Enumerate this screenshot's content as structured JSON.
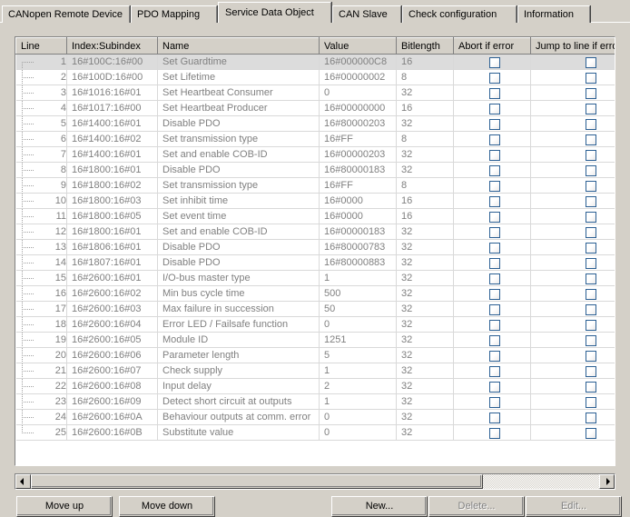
{
  "tabs": [
    {
      "label": "CANopen Remote Device",
      "active": false
    },
    {
      "label": "PDO Mapping",
      "active": false
    },
    {
      "label": "Service Data Object",
      "active": true
    },
    {
      "label": "CAN Slave",
      "active": false
    },
    {
      "label": "Check configuration",
      "active": false
    },
    {
      "label": "Information",
      "active": false
    }
  ],
  "grid": {
    "columns": [
      {
        "key": "line",
        "label": "Line"
      },
      {
        "key": "index",
        "label": "Index:Subindex"
      },
      {
        "key": "name",
        "label": "Name"
      },
      {
        "key": "value",
        "label": "Value"
      },
      {
        "key": "bitlength",
        "label": "Bitlength"
      },
      {
        "key": "abort",
        "label": "Abort if error"
      },
      {
        "key": "jump",
        "label": "Jump to line if error"
      }
    ],
    "selected_row": 1,
    "rows": [
      {
        "line": "1",
        "index": "16#100C:16#00",
        "name": "Set Guardtime",
        "value": "16#000000C8",
        "bitlength": "16",
        "abort": false,
        "jump": false
      },
      {
        "line": "2",
        "index": "16#100D:16#00",
        "name": "Set Lifetime",
        "value": "16#00000002",
        "bitlength": "8",
        "abort": false,
        "jump": false
      },
      {
        "line": "3",
        "index": "16#1016:16#01",
        "name": "Set Heartbeat Consumer",
        "value": "0",
        "bitlength": "32",
        "abort": false,
        "jump": false
      },
      {
        "line": "4",
        "index": "16#1017:16#00",
        "name": "Set Heartbeat Producer",
        "value": "16#00000000",
        "bitlength": "16",
        "abort": false,
        "jump": false
      },
      {
        "line": "5",
        "index": "16#1400:16#01",
        "name": "Disable PDO",
        "value": "16#80000203",
        "bitlength": "32",
        "abort": false,
        "jump": false
      },
      {
        "line": "6",
        "index": "16#1400:16#02",
        "name": "Set transmission type",
        "value": "16#FF",
        "bitlength": "8",
        "abort": false,
        "jump": false
      },
      {
        "line": "7",
        "index": "16#1400:16#01",
        "name": "Set and enable COB-ID",
        "value": "16#00000203",
        "bitlength": "32",
        "abort": false,
        "jump": false
      },
      {
        "line": "8",
        "index": "16#1800:16#01",
        "name": "Disable PDO",
        "value": "16#80000183",
        "bitlength": "32",
        "abort": false,
        "jump": false
      },
      {
        "line": "9",
        "index": "16#1800:16#02",
        "name": "Set transmission type",
        "value": "16#FF",
        "bitlength": "8",
        "abort": false,
        "jump": false
      },
      {
        "line": "10",
        "index": "16#1800:16#03",
        "name": "Set inhibit time",
        "value": "16#0000",
        "bitlength": "16",
        "abort": false,
        "jump": false
      },
      {
        "line": "11",
        "index": "16#1800:16#05",
        "name": "Set event time",
        "value": "16#0000",
        "bitlength": "16",
        "abort": false,
        "jump": false
      },
      {
        "line": "12",
        "index": "16#1800:16#01",
        "name": "Set and enable COB-ID",
        "value": "16#00000183",
        "bitlength": "32",
        "abort": false,
        "jump": false
      },
      {
        "line": "13",
        "index": "16#1806:16#01",
        "name": "Disable PDO",
        "value": "16#80000783",
        "bitlength": "32",
        "abort": false,
        "jump": false
      },
      {
        "line": "14",
        "index": "16#1807:16#01",
        "name": "Disable PDO",
        "value": "16#80000883",
        "bitlength": "32",
        "abort": false,
        "jump": false
      },
      {
        "line": "15",
        "index": "16#2600:16#01",
        "name": "I/O-bus master type",
        "value": "1",
        "bitlength": "32",
        "abort": false,
        "jump": false
      },
      {
        "line": "16",
        "index": "16#2600:16#02",
        "name": "Min bus cycle time",
        "value": "500",
        "bitlength": "32",
        "abort": false,
        "jump": false
      },
      {
        "line": "17",
        "index": "16#2600:16#03",
        "name": "Max failure in succession",
        "value": "50",
        "bitlength": "32",
        "abort": false,
        "jump": false
      },
      {
        "line": "18",
        "index": "16#2600:16#04",
        "name": "Error LED / Failsafe function",
        "value": "0",
        "bitlength": "32",
        "abort": false,
        "jump": false
      },
      {
        "line": "19",
        "index": "16#2600:16#05",
        "name": "Module ID",
        "value": "1251",
        "bitlength": "32",
        "abort": false,
        "jump": false
      },
      {
        "line": "20",
        "index": "16#2600:16#06",
        "name": "Parameter length",
        "value": "5",
        "bitlength": "32",
        "abort": false,
        "jump": false
      },
      {
        "line": "21",
        "index": "16#2600:16#07",
        "name": "Check supply",
        "value": "1",
        "bitlength": "32",
        "abort": false,
        "jump": false
      },
      {
        "line": "22",
        "index": "16#2600:16#08",
        "name": "Input delay",
        "value": "2",
        "bitlength": "32",
        "abort": false,
        "jump": false
      },
      {
        "line": "23",
        "index": "16#2600:16#09",
        "name": "Detect short circuit at outputs",
        "value": "1",
        "bitlength": "32",
        "abort": false,
        "jump": false
      },
      {
        "line": "24",
        "index": "16#2600:16#0A",
        "name": "Behaviour outputs at comm. error",
        "value": "0",
        "bitlength": "32",
        "abort": false,
        "jump": false
      },
      {
        "line": "25",
        "index": "16#2600:16#0B",
        "name": "Substitute value",
        "value": "0",
        "bitlength": "32",
        "abort": false,
        "jump": false
      }
    ]
  },
  "buttons": {
    "move_up": {
      "label": "Move up",
      "enabled": true
    },
    "move_down": {
      "label": "Move down",
      "enabled": true
    },
    "new": {
      "label": "New...",
      "enabled": true
    },
    "delete": {
      "label": "Delete...",
      "enabled": false
    },
    "edit": {
      "label": "Edit...",
      "enabled": false
    }
  },
  "scrollbar": {
    "left_arrow": "left-arrow-icon",
    "right_arrow": "right-arrow-icon"
  },
  "colors": {
    "face": "#d4d0c8",
    "checkbox_border": "#2b5f93",
    "row_text": "#808080",
    "selection": "#dcdcdc"
  }
}
